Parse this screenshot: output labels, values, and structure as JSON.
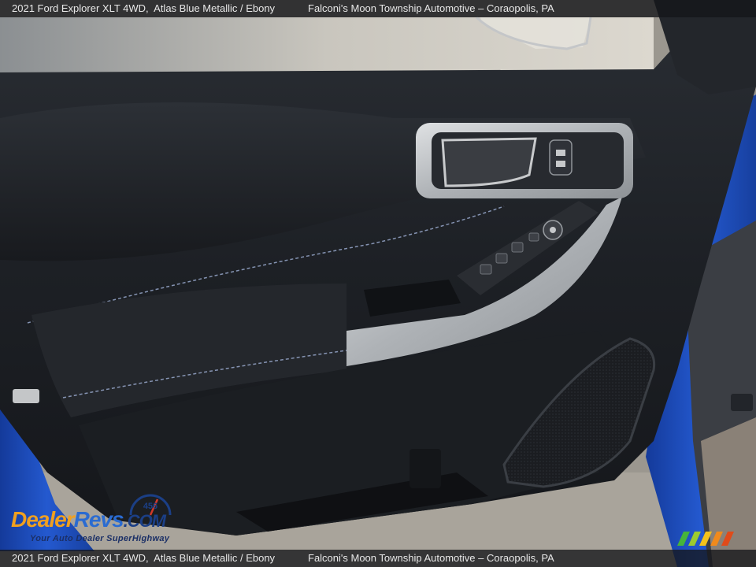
{
  "caption": {
    "vehicle": "2021 Ford Explorer XLT 4WD,  Atlas Blue Metallic / Ebony",
    "dealer": "Falconi's Moon Township Automotive – Coraopolis, PA"
  },
  "watermark": {
    "brand_dealer": "Dealer",
    "brand_revs": "Revs",
    "brand_com": ".COM",
    "tagline": "Your Auto Dealer SuperHighway",
    "speedo_digits": "456"
  },
  "colors": {
    "exterior_paint": "#1f4fb8",
    "door_panel": "#1c1f24",
    "silver_trim": "#b9bcc0",
    "stitching": "#9fb0d6"
  },
  "icons": [
    "door-handle-icon",
    "door-lock-switch-icon",
    "mirror-control-icon",
    "window-switches-icon",
    "speaker-grille-icon"
  ]
}
